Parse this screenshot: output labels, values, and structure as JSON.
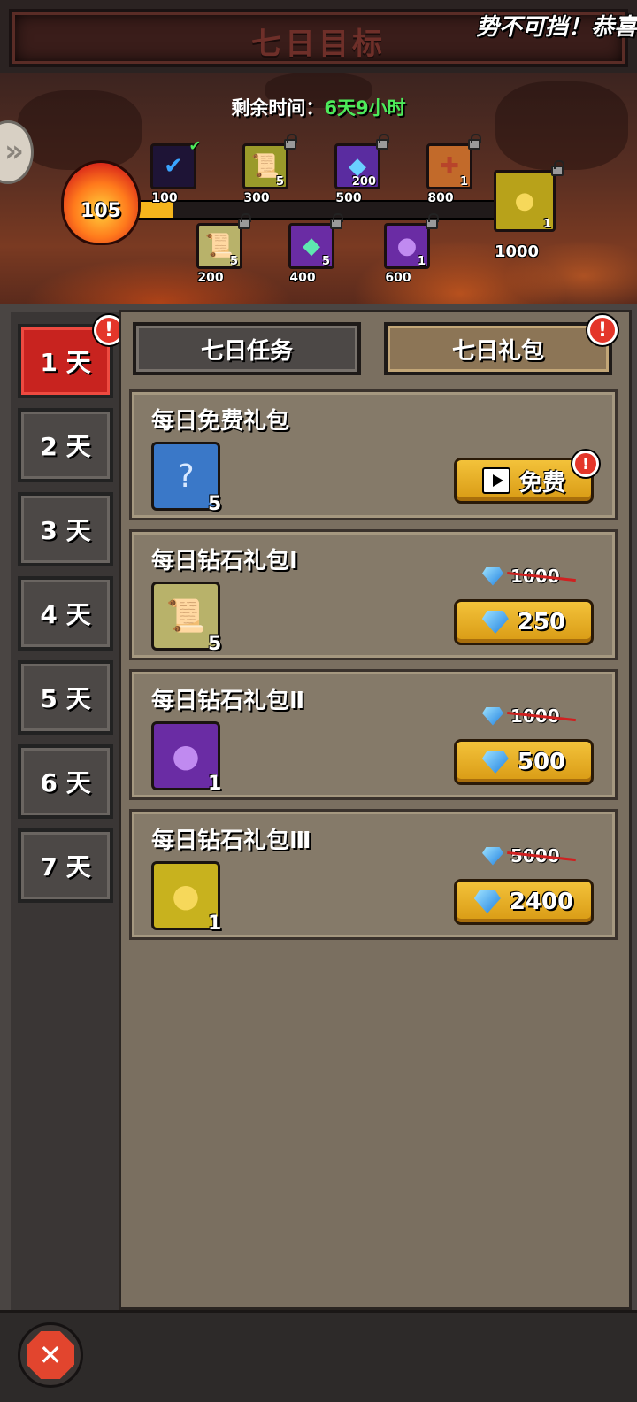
{
  "header": {
    "title": "七日目标",
    "marquee": "势不可挡！恭喜"
  },
  "banner": {
    "remain_label": "剩余时间：",
    "remain_value": "6天9小时",
    "score": "105",
    "progress": 0.105
  },
  "milestones": [
    {
      "threshold": "100",
      "icon": "check-icon",
      "count": "",
      "status": "claimed",
      "color": "#1e1436"
    },
    {
      "threshold": "200",
      "icon": "scroll-icon",
      "count": "5",
      "status": "locked",
      "color": "#b8b26a"
    },
    {
      "threshold": "300",
      "icon": "scroll-icon",
      "count": "5",
      "status": "locked",
      "color": "#9a9a2a"
    },
    {
      "threshold": "400",
      "icon": "crystal-icon",
      "count": "5",
      "status": "locked",
      "color": "#6a2ca4"
    },
    {
      "threshold": "500",
      "icon": "diamond-icon",
      "count": "200",
      "status": "locked",
      "color": "#5a2ca0"
    },
    {
      "threshold": "600",
      "icon": "bag-icon",
      "count": "1",
      "status": "locked",
      "color": "#6a2ca4"
    },
    {
      "threshold": "800",
      "icon": "map-icon",
      "count": "1",
      "status": "locked",
      "color": "#c26a2a"
    },
    {
      "threshold": "1000",
      "icon": "gold-bag-icon",
      "count": "1",
      "status": "locked",
      "color": "#b8a21a"
    }
  ],
  "days": [
    "1 天",
    "2 天",
    "3 天",
    "4 天",
    "5 天",
    "6 天",
    "7 天"
  ],
  "active_day": 0,
  "tabs": {
    "tasks": "七日任务",
    "packs": "七日礼包"
  },
  "packs": [
    {
      "title": "每日免费礼包",
      "item_icon": "card-icon",
      "count": "5",
      "button": "免费",
      "old_price": "",
      "color": "#3a78c8"
    },
    {
      "title": "每日钻石礼包Ⅰ",
      "item_icon": "scroll-icon",
      "count": "5",
      "button": "250",
      "old_price": "1000",
      "color": "#b8b26a"
    },
    {
      "title": "每日钻石礼包Ⅱ",
      "item_icon": "bag-icon",
      "count": "1",
      "button": "500",
      "old_price": "1000",
      "color": "#6a2ca4"
    },
    {
      "title": "每日钻石礼包Ⅲ",
      "item_icon": "gold-bag-icon",
      "count": "1",
      "button": "2400",
      "old_price": "5000",
      "color": "#c8b21e"
    }
  ],
  "alert_mark": "!",
  "close_mark": "✕"
}
